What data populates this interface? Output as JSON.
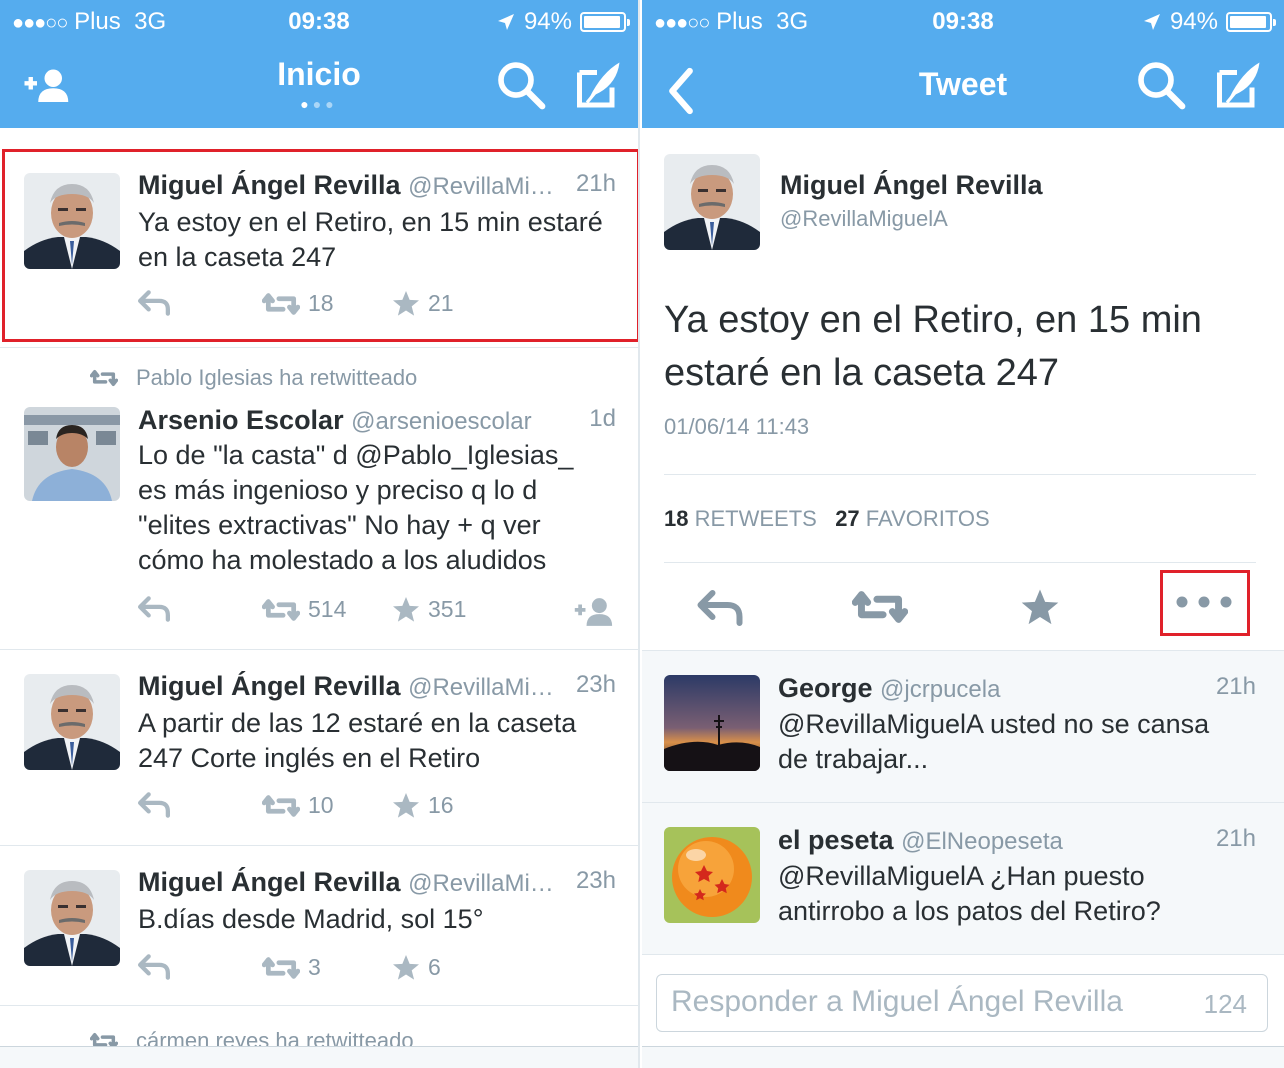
{
  "colors": {
    "brand": "#55acee",
    "highlight": "#e0212a",
    "muted": "#8899a6",
    "text": "#292f33"
  },
  "status_bar": {
    "carrier": "Plus",
    "network": "3G",
    "time": "09:38",
    "battery": "94%",
    "battery_level": 0.94
  },
  "left": {
    "title": "Inicio",
    "icons": {
      "left": "add-user-icon",
      "right": [
        "search-icon",
        "compose-icon"
      ]
    },
    "tweets": [
      {
        "name": "Miguel Ángel Revilla",
        "handle": "@RevillaMi…",
        "ago": "21h",
        "text": "Ya estoy en el Retiro, en 15 min estaré en la caseta 247",
        "retweets": "18",
        "favorites": "21"
      },
      {
        "retweeted_by": "Pablo Iglesias ha retwitteado",
        "name": "Arsenio Escolar",
        "handle": "@arsenioescolar",
        "ago": "1d",
        "text": "Lo de \"la casta\" d @Pablo_Iglesias_ es más ingenioso y preciso q lo d \"elites extractivas\" No hay + q ver cómo ha molestado a los aludidos",
        "retweets": "514",
        "favorites": "351"
      },
      {
        "name": "Miguel Ángel Revilla",
        "handle": "@RevillaMi…",
        "ago": "23h",
        "text": "A partir de las 12 estaré en la caseta 247 Corte inglés en el Retiro",
        "retweets": "10",
        "favorites": "16"
      },
      {
        "name": "Miguel Ángel Revilla",
        "handle": "@RevillaMi…",
        "ago": "23h",
        "text": "B.días desde Madrid, sol 15°",
        "retweets": "3",
        "favorites": "6"
      }
    ],
    "partial_retweet_note": "cármen reyes ha retwitteado"
  },
  "right": {
    "title": "Tweet",
    "icons": {
      "left": "back-chevron-icon",
      "right": [
        "search-icon",
        "compose-icon"
      ]
    },
    "author": {
      "name": "Miguel Ángel Revilla",
      "handle": "@RevillaMiguelA"
    },
    "text": "Ya estoy en el Retiro, en 15 min estaré en la caseta 247",
    "timestamp": "01/06/14 11:43",
    "stats": {
      "retweets_count": "18",
      "retweets_label": "RETWEETS",
      "favorites_count": "27",
      "favorites_label": "FAVORITOS"
    },
    "replies": [
      {
        "name": "George",
        "handle": "@jcrpucela",
        "ago": "21h",
        "text": "@RevillaMiguelA usted no se cansa de trabajar..."
      },
      {
        "name": "el peseta",
        "handle": "@ElNeopeseta",
        "ago": "21h",
        "text": "@RevillaMiguelA ¿Han puesto antirrobo a los patos del Retiro?"
      }
    ],
    "reply_box": {
      "placeholder": "Responder a Miguel Ángel Revilla",
      "counter": "124"
    }
  }
}
